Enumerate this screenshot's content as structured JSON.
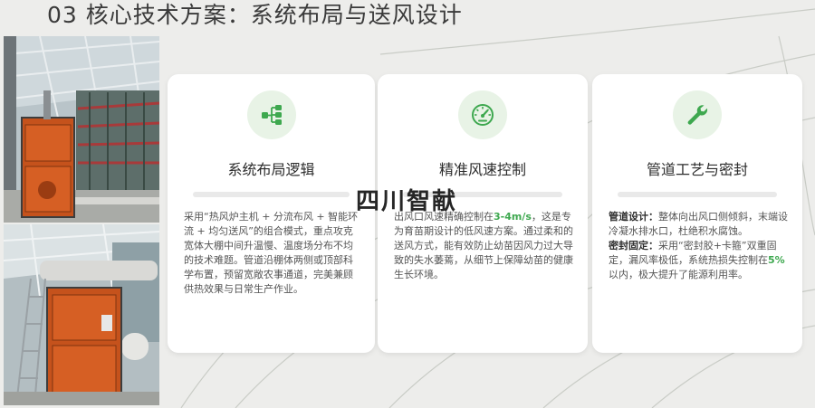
{
  "page": {
    "title": "03 核心技术方案：系统布局与送风设计",
    "watermark": "四川智献"
  },
  "colors": {
    "accent": "#3ea84f",
    "icon_bg": "#e8f3e6",
    "card_bg": "#ffffff",
    "page_bg": "#ededeb"
  },
  "cards": [
    {
      "title": "系统布局逻辑",
      "icon": "hierarchy-icon",
      "body": "采用“热风炉主机 + 分流布风 + 智能环流 + 均匀送风”的组合模式，重点攻克宽体大棚中间升温慢、温度场分布不均的技术难题。管道沿棚体两侧或顶部科学布置，预留宽敞农事通道，完美兼顾供热效果与日常生产作业。"
    },
    {
      "title": "精准风速控制",
      "icon": "gauge-icon",
      "body_pre": "出风口风速精确控制在",
      "body_highlight": "3-4m/s",
      "body_post": "，这是专为育苗期设计的低风速方案。通过柔和的送风方式，能有效防止幼苗因风力过大导致的失水萎蔫，从细节上保障幼苗的健康生长环境。"
    },
    {
      "title": "管道工艺与密封",
      "icon": "wrench-icon",
      "label_1": "管道设计：",
      "text_1": "整体向出风口侧倾斜，末端设冷凝水排水口，杜绝积水腐蚀。",
      "label_2": "密封固定：",
      "text_2_pre": "采用“密封胶+卡箍”双重固定，漏风率极低，系统热损失控制在",
      "text_2_highlight": "5%",
      "text_2_post": "以内，极大提升了能源利用率。"
    }
  ]
}
